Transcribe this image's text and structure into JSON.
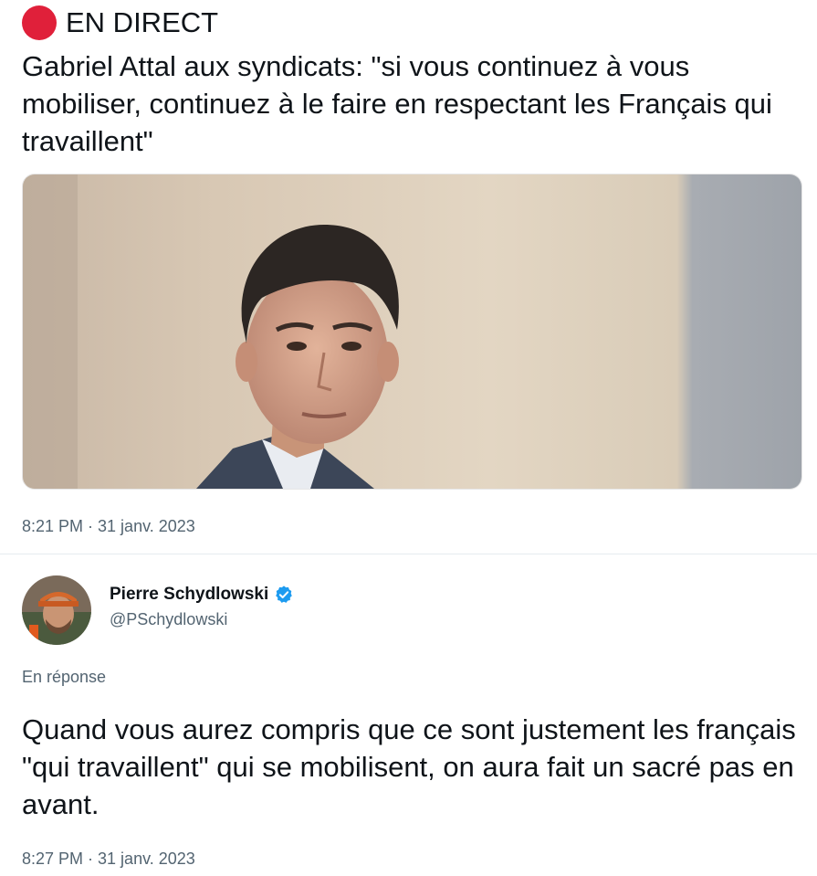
{
  "post": {
    "live_label": "EN DIRECT",
    "headline": "Gabriel Attal aux syndicats: \"si vous continuez à vous mobiliser, continuez à le faire en respectant les Français qui travaillent\"",
    "live_color": "#e0203a",
    "timestamp": "8:21 PM · 31 janv. 2023"
  },
  "reply": {
    "display_name": "Pierre Schydlowski",
    "handle": "@PSchydlowski",
    "verified_icon": "verified-badge-icon",
    "verified_color": "#1d9bf0",
    "context_label": "En réponse",
    "text": "Quand vous aurez compris que ce sont justement les français \"qui travaillent\" qui se mobilisent, on aura fait un sacré pas en avant.",
    "timestamp": "8:27 PM · 31 janv. 2023"
  }
}
